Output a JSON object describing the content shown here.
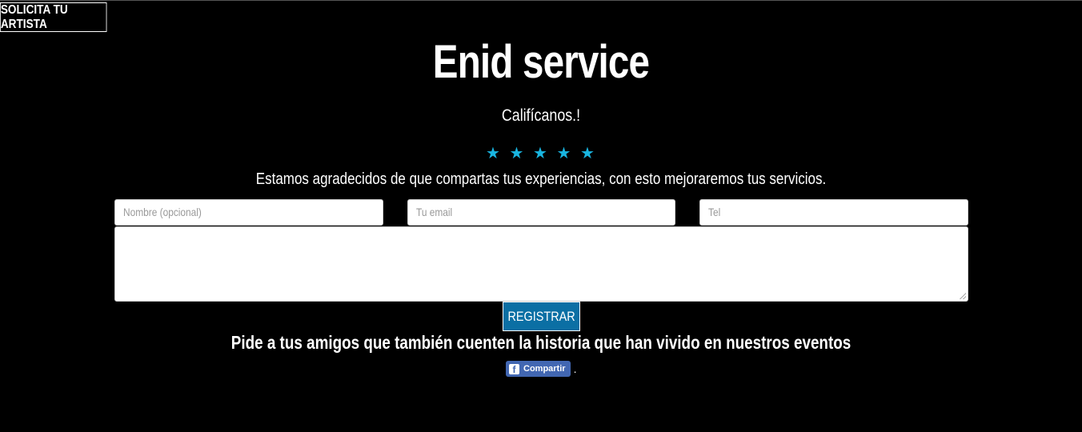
{
  "header": {
    "request_artist_label": "SOLICITA TU ARTISTA"
  },
  "main": {
    "title": "Enid service",
    "subtitle": "Califícanos.!",
    "stars": [
      "★",
      "★",
      "★",
      "★",
      "★"
    ],
    "star_color": "#19b5e0",
    "thanks_text": "Estamos agradecidos de que compartas tus experiencias, con esto mejoraremos tus servicios."
  },
  "form": {
    "name_placeholder": "Nombre (opcional)",
    "email_placeholder": "Tu email",
    "phone_placeholder": "Tel",
    "register_label": "REGISTRAR",
    "register_color": "#0b6fa4"
  },
  "share": {
    "ask_text": "Pide a tus amigos que también cuenten la historia que han vivido en nuestros eventos",
    "facebook_label": "Compartir",
    "facebook_icon": "f",
    "trailing_dot": ".",
    "facebook_color": "#4267b2"
  }
}
